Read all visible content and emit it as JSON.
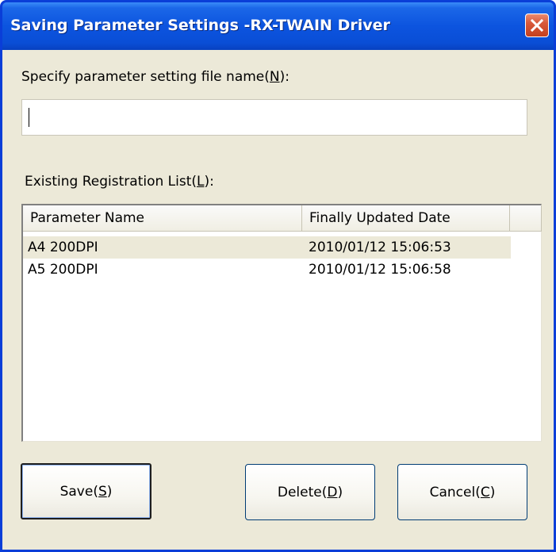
{
  "window": {
    "title": "Saving Parameter Settings -RX-TWAIN Driver"
  },
  "filename": {
    "label_text": "Specify parameter setting file name(",
    "label_key": "N",
    "label_tail": "):",
    "value": ""
  },
  "list": {
    "label_text": "Existing Registration List(",
    "label_key": "L",
    "label_tail": "):",
    "columns": [
      "Parameter Name",
      "Finally Updated Date"
    ],
    "rows": [
      {
        "name": "A4 200DPI",
        "date": "2010/01/12 15:06:53"
      },
      {
        "name": "A5 200DPI",
        "date": "2010/01/12 15:06:58"
      }
    ]
  },
  "buttons": {
    "save": {
      "text": "Save(",
      "key": "S",
      "tail": ")"
    },
    "delete": {
      "text": "Delete(",
      "key": "D",
      "tail": ")"
    },
    "cancel": {
      "text": "Cancel(",
      "key": "C",
      "tail": ")"
    }
  },
  "icons": {
    "close": "close-icon"
  },
  "colors": {
    "titlebar": "#0a4ed6",
    "client": "#ece9d8",
    "close": "#d8593a",
    "selected_row": "#ece9d8"
  }
}
